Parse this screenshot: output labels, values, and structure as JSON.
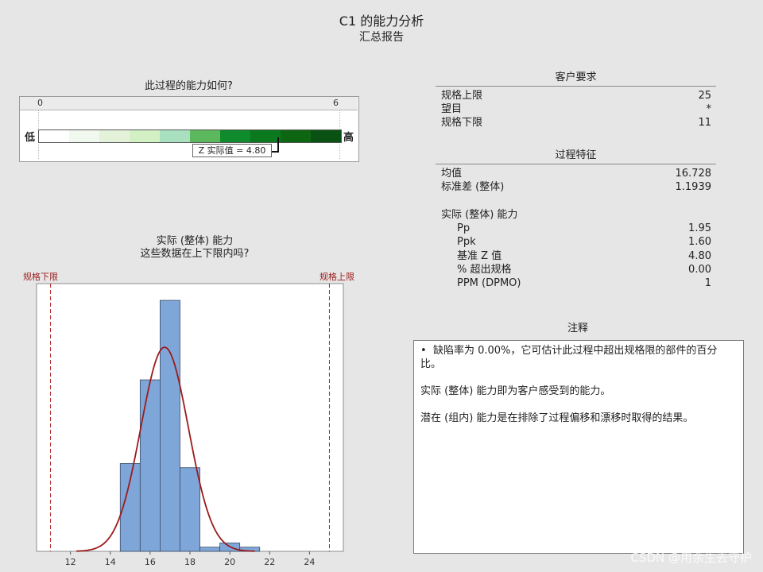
{
  "header": {
    "title": "C1 的能力分析",
    "subtitle": "汇总报告"
  },
  "gauge": {
    "question": "此过程的能力如何?",
    "scale_min": "0",
    "scale_max": "6",
    "low_label": "低",
    "high_label": "高",
    "z_label": "Z 实际值 = 4.80",
    "z_value": 4.8,
    "segment_colors": [
      "#ffffff",
      "#f1f8ee",
      "#e3f2d9",
      "#d3f0c5",
      "#a8e0c0",
      "#5cb85c",
      "#0f8a2c",
      "#0b7a1f",
      "#0c6612",
      "#0a5214"
    ]
  },
  "customer_requirements": {
    "title": "客户要求",
    "rows": [
      {
        "label": "规格上限",
        "value": "25"
      },
      {
        "label": "望目",
        "value": "*"
      },
      {
        "label": "规格下限",
        "value": "11"
      }
    ]
  },
  "process_characteristics": {
    "title": "过程特征",
    "mean_label": "均值",
    "mean_value": "16.728",
    "sd_label": "标准差 (整体)",
    "sd_value": "1.1939",
    "capability_heading": "实际 (整体) 能力",
    "capability_rows": [
      {
        "label": "Pp",
        "value": "1.95"
      },
      {
        "label": "Ppk",
        "value": "1.60"
      },
      {
        "label": "基准 Z 值",
        "value": "4.80"
      },
      {
        "label": "% 超出规格",
        "value": "0.00"
      },
      {
        "label": "PPM (DPMO)",
        "value": "1"
      }
    ]
  },
  "histogram": {
    "title_line1": "实际 (整体) 能力",
    "title_line2": "这些数据在上下限内吗?",
    "lsl_label": "规格下限",
    "usl_label": "规格上限"
  },
  "chart_data": {
    "type": "bar",
    "bin_edges": [
      14.5,
      15.5,
      16.5,
      17.5,
      18.5,
      19.5,
      20.5,
      21.5
    ],
    "values": [
      21,
      41,
      60,
      20,
      1,
      2,
      1
    ],
    "normal_curve": {
      "mean": 16.728,
      "sd": 1.1939
    },
    "x_ticks": [
      12,
      14,
      16,
      18,
      20,
      22,
      24
    ],
    "xlim": [
      10.3,
      25.7
    ],
    "ylim": [
      0,
      64
    ],
    "lsl": 11,
    "usl": 25,
    "colors": {
      "bar": "#7fa6d9",
      "bar_edge": "#3b4a63",
      "curve": "#9b1b1b",
      "spec": "#b02424"
    }
  },
  "notes": {
    "title": "注释",
    "bullet": "•",
    "line1": "缺陷率为 0.00%，它可估计此过程中超出规格限的部件的百分",
    "line2": "比。",
    "line3": "实际 (整体) 能力即为客户感受到的能力。",
    "line4": "潜在 (组内) 能力是在排除了过程偏移和漂移时取得的结果。"
  },
  "watermark": "CSDN @用余生去守护"
}
